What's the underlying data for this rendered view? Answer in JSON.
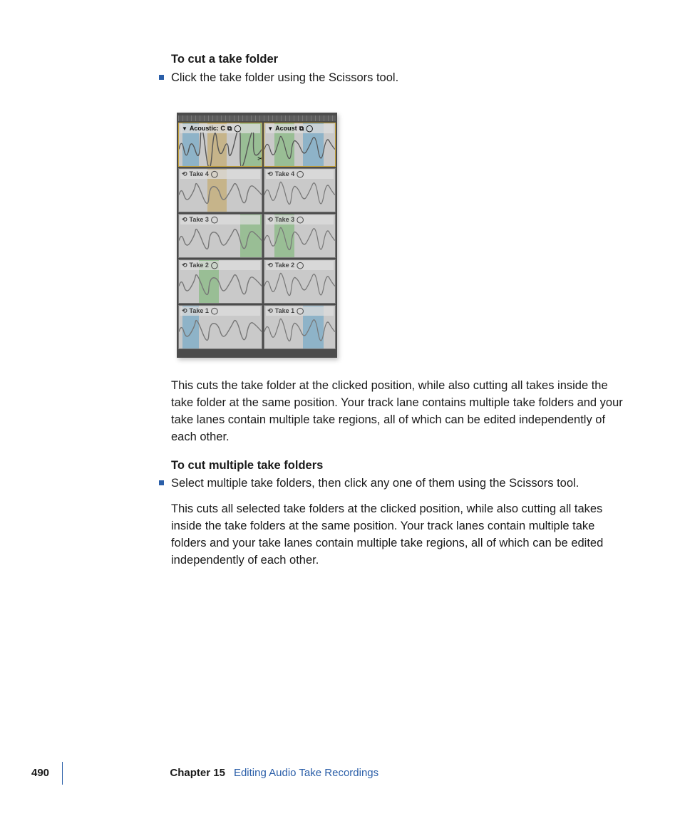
{
  "section1": {
    "heading": "To cut a take folder",
    "bullet": "Click the take folder using the Scissors tool.",
    "para": "This cuts the take folder at the clicked position, while also cutting all takes inside the take folder at the same position. Your track lane contains multiple take folders and your take lanes contain multiple take regions, all of which can be edited independently of each other."
  },
  "section2": {
    "heading": "To cut multiple take folders",
    "bullet": "Select multiple take folders, then click any one of them using the Scissors tool.",
    "para": "This cuts all selected take folders at the clicked position, while also cutting all takes inside the take folders at the same position. Your track lanes contain multiple take folders and your take lanes contain multiple take regions, all of which can be edited independently of each other."
  },
  "figure": {
    "header": {
      "left_label": "Acoustic: C",
      "right_label": "Acoust"
    },
    "takes": [
      "Take 4",
      "Take 3",
      "Take 2",
      "Take 1"
    ]
  },
  "footer": {
    "page": "490",
    "chapter": "Chapter 15",
    "title": "Editing Audio Take Recordings"
  }
}
